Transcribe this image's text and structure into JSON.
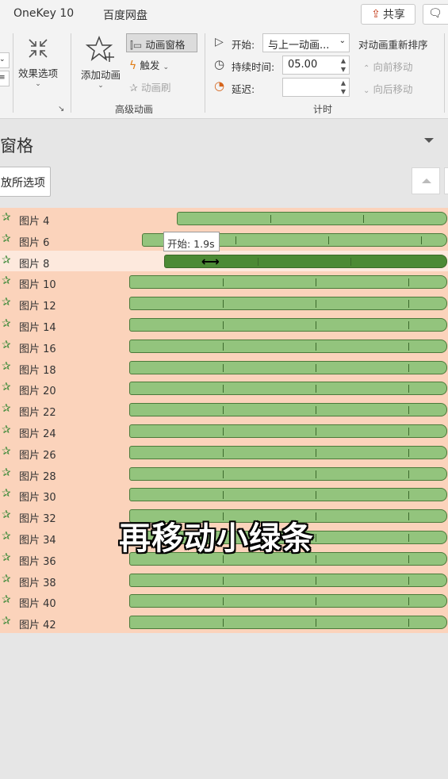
{
  "tabs": {
    "onekey": "OneKey 10",
    "baidu": "百度网盘"
  },
  "share": {
    "label": "共享"
  },
  "ribbon": {
    "effect_options": "效果选项",
    "add_animation": "添加动画",
    "animation_pane": "动画窗格",
    "trigger": "触发",
    "animation_painter": "动画刷",
    "advanced_group": "高级动画",
    "start_label": "开始:",
    "start_value": "与上一动画...",
    "duration_label": "持续时间:",
    "duration_value": "05.00",
    "delay_label": "延迟:",
    "delay_value": "",
    "timing_group": "计时",
    "reorder_title": "对动画重新排序",
    "move_earlier": "向前移动",
    "move_later": "向后移动"
  },
  "pane": {
    "title": "窗格",
    "play_button": "放所选项"
  },
  "tooltip": "开始: 1.9s",
  "caption": "再移动小绿条",
  "items": [
    {
      "label": "图片 4",
      "start": 0.15,
      "end": 1.0,
      "selected": false
    },
    {
      "label": "图片 6",
      "start": 0.04,
      "end": 1.0,
      "selected": false
    },
    {
      "label": "图片 8",
      "start": 0.11,
      "end": 1.0,
      "selected": true
    },
    {
      "label": "图片 10",
      "start": 0.0,
      "end": 1.0,
      "selected": false
    },
    {
      "label": "图片 12",
      "start": 0.0,
      "end": 1.0,
      "selected": false
    },
    {
      "label": "图片 14",
      "start": 0.0,
      "end": 1.0,
      "selected": false
    },
    {
      "label": "图片 16",
      "start": 0.0,
      "end": 1.0,
      "selected": false
    },
    {
      "label": "图片 18",
      "start": 0.0,
      "end": 1.0,
      "selected": false
    },
    {
      "label": "图片 20",
      "start": 0.0,
      "end": 1.0,
      "selected": false
    },
    {
      "label": "图片 22",
      "start": 0.0,
      "end": 1.0,
      "selected": false
    },
    {
      "label": "图片 24",
      "start": 0.0,
      "end": 1.0,
      "selected": false
    },
    {
      "label": "图片 26",
      "start": 0.0,
      "end": 1.0,
      "selected": false
    },
    {
      "label": "图片 28",
      "start": 0.0,
      "end": 1.0,
      "selected": false
    },
    {
      "label": "图片 30",
      "start": 0.0,
      "end": 1.0,
      "selected": false
    },
    {
      "label": "图片 32",
      "start": 0.0,
      "end": 1.0,
      "selected": false
    },
    {
      "label": "图片 34",
      "start": 0.0,
      "end": 1.0,
      "selected": false
    },
    {
      "label": "图片 36",
      "start": 0.0,
      "end": 1.0,
      "selected": false
    },
    {
      "label": "图片 38",
      "start": 0.0,
      "end": 1.0,
      "selected": false
    },
    {
      "label": "图片 40",
      "start": 0.0,
      "end": 1.0,
      "selected": false
    },
    {
      "label": "图片 42",
      "start": 0.0,
      "end": 1.0,
      "selected": false
    }
  ]
}
